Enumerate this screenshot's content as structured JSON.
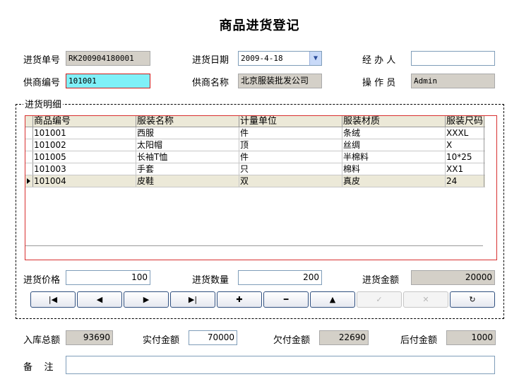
{
  "window": {
    "title": "商品进货登记"
  },
  "form": {
    "order_no_label": "进货单号",
    "order_no": "RK200904180001",
    "date_label": "进货日期",
    "date": "2009-4-18",
    "handler_label": "经 办 人",
    "handler": "",
    "supplier_code_label": "供商编号",
    "supplier_code": "101001",
    "supplier_name_label": "供商名称",
    "supplier_name": "北京服装批发公司",
    "operator_label": "操 作 员",
    "operator": "Admin"
  },
  "details": {
    "group_title": "进货明细",
    "columns": [
      "商品编号",
      "服装名称",
      "计量单位",
      "服装材质",
      "服装尺码"
    ],
    "rows": [
      [
        "101001",
        "西服",
        "件",
        "条绒",
        "XXXL"
      ],
      [
        "101002",
        "太阳帽",
        "顶",
        "丝绸",
        "X"
      ],
      [
        "101005",
        "长袖T恤",
        "件",
        "半棉料",
        "10*25"
      ],
      [
        "101003",
        "手套",
        "只",
        "棉料",
        "XX1"
      ],
      [
        "101004",
        "皮鞋",
        "双",
        "真皮",
        "24"
      ]
    ],
    "price_label": "进货价格",
    "price": "100",
    "quantity_label": "进货数量",
    "quantity": "200",
    "amount_label": "进货金额",
    "amount": "20000"
  },
  "nav_buttons": [
    {
      "name": "first-record-button",
      "glyph": "|◀",
      "enabled": true
    },
    {
      "name": "prev-record-button",
      "glyph": "◀",
      "enabled": true
    },
    {
      "name": "next-record-button",
      "glyph": "▶",
      "enabled": true
    },
    {
      "name": "last-record-button",
      "glyph": "▶|",
      "enabled": true
    },
    {
      "name": "add-record-button",
      "glyph": "✚",
      "enabled": true
    },
    {
      "name": "delete-record-button",
      "glyph": "━",
      "enabled": true
    },
    {
      "name": "edit-record-button",
      "glyph": "▲",
      "enabled": true
    },
    {
      "name": "post-record-button",
      "glyph": "✓",
      "enabled": false
    },
    {
      "name": "cancel-record-button",
      "glyph": "✕",
      "enabled": false
    },
    {
      "name": "refresh-button",
      "glyph": "↻",
      "enabled": true
    }
  ],
  "totals": {
    "total_label": "入库总额",
    "total": "93690",
    "paid_label": "实付金额",
    "paid": "70000",
    "owed_label": "欠付金额",
    "owed": "22690",
    "later_label": "后付金额",
    "later": "1000"
  },
  "remark": {
    "label": "备    注",
    "value": ""
  }
}
